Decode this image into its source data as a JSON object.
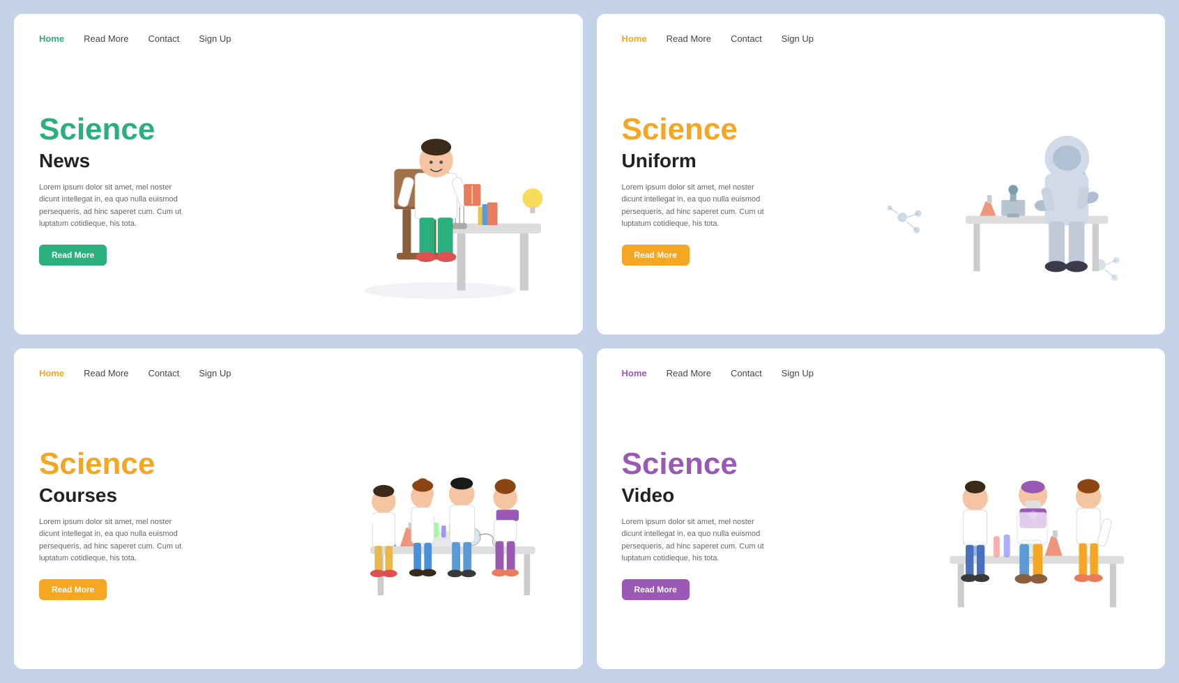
{
  "cards": [
    {
      "id": "science-news",
      "nav": [
        {
          "label": "Home",
          "active": true,
          "theme": "green"
        },
        {
          "label": "Read More",
          "active": false
        },
        {
          "label": "Contact",
          "active": false
        },
        {
          "label": "Sign Up",
          "active": false
        }
      ],
      "title_large": "Science",
      "title_sub": "News",
      "title_theme": "green",
      "description": "Lorem ipsum dolor sit amet, mel noster dicunt intellegat in, ea quo nulla euismod persequeris, ad hinc saperet cum. Cum ut luptatum cotidieque, his tota.",
      "btn_label": "Read More",
      "btn_theme": "green"
    },
    {
      "id": "science-uniform",
      "nav": [
        {
          "label": "Home",
          "active": true,
          "theme": "orange"
        },
        {
          "label": "Read More",
          "active": false
        },
        {
          "label": "Contact",
          "active": false
        },
        {
          "label": "Sign Up",
          "active": false
        }
      ],
      "title_large": "Science",
      "title_sub": "Uniform",
      "title_theme": "orange",
      "description": "Lorem ipsum dolor sit amet, mel noster dicunt intellegat in, ea quo nulla euismod persequeris, ad hinc saperet cum. Cum ut luptatum cotidieque, his tota.",
      "btn_label": "Read More",
      "btn_theme": "orange"
    },
    {
      "id": "science-courses",
      "nav": [
        {
          "label": "Home",
          "active": true,
          "theme": "orange"
        },
        {
          "label": "Read More",
          "active": false
        },
        {
          "label": "Contact",
          "active": false
        },
        {
          "label": "Sign Up",
          "active": false
        }
      ],
      "title_large": "Science",
      "title_sub": "Courses",
      "title_theme": "orange",
      "description": "Lorem ipsum dolor sit amet, mel noster dicunt intellegat in, ea quo nulla euismod persequeris, ad hinc saperet cum. Cum ut luptatum cotidieque, his tota.",
      "btn_label": "Read More",
      "btn_theme": "orange"
    },
    {
      "id": "science-video",
      "nav": [
        {
          "label": "Home",
          "active": true,
          "theme": "purple"
        },
        {
          "label": "Read More",
          "active": false
        },
        {
          "label": "Contact",
          "active": false
        },
        {
          "label": "Sign Up",
          "active": false
        }
      ],
      "title_large": "Science",
      "title_sub": "Video",
      "title_theme": "purple",
      "description": "Lorem ipsum dolor sit amet, mel noster dicunt intellegat in, ea quo nulla euismod persequeris, ad hinc saperet cum. Cum ut luptatum cotidieque, his tota.",
      "btn_label": "Read More",
      "btn_theme": "purple"
    }
  ]
}
